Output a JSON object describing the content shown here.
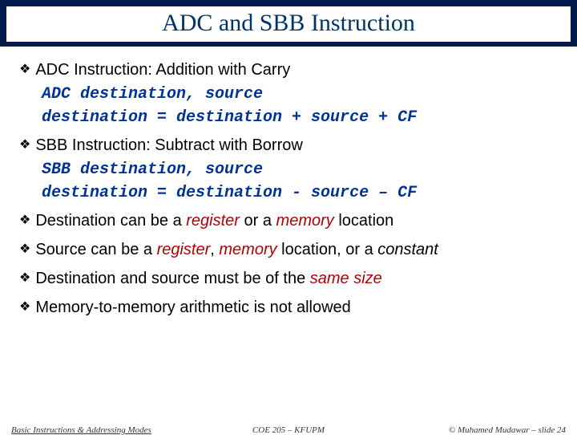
{
  "title": "ADC and SBB Instruction",
  "bullets": {
    "b1": "ADC Instruction: Addition with Carry",
    "c1": "ADC destination, source",
    "c2": "destination = destination + source + CF",
    "b2": "SBB Instruction: Subtract with Borrow",
    "c3": "SBB destination, source",
    "c4": "destination = destination - source – CF",
    "b3_pre": "Destination can be a ",
    "b3_reg": "register",
    "b3_mid": " or a ",
    "b3_mem": "memory",
    "b3_post": " location",
    "b4_pre": "Source can be a ",
    "b4_reg": "register",
    "b4_mid1": ", ",
    "b4_mem": "memory",
    "b4_mid2": " location, or a ",
    "b4_con": "constant",
    "b5_pre": "Destination and source must be of the ",
    "b5_same": "same size",
    "b6": "Memory-to-memory arithmetic is not allowed"
  },
  "footer": {
    "left": "Basic Instructions & Addressing Modes",
    "center": "COE 205 – KFUPM",
    "right": "© Muhamed Mudawar – slide 24"
  }
}
